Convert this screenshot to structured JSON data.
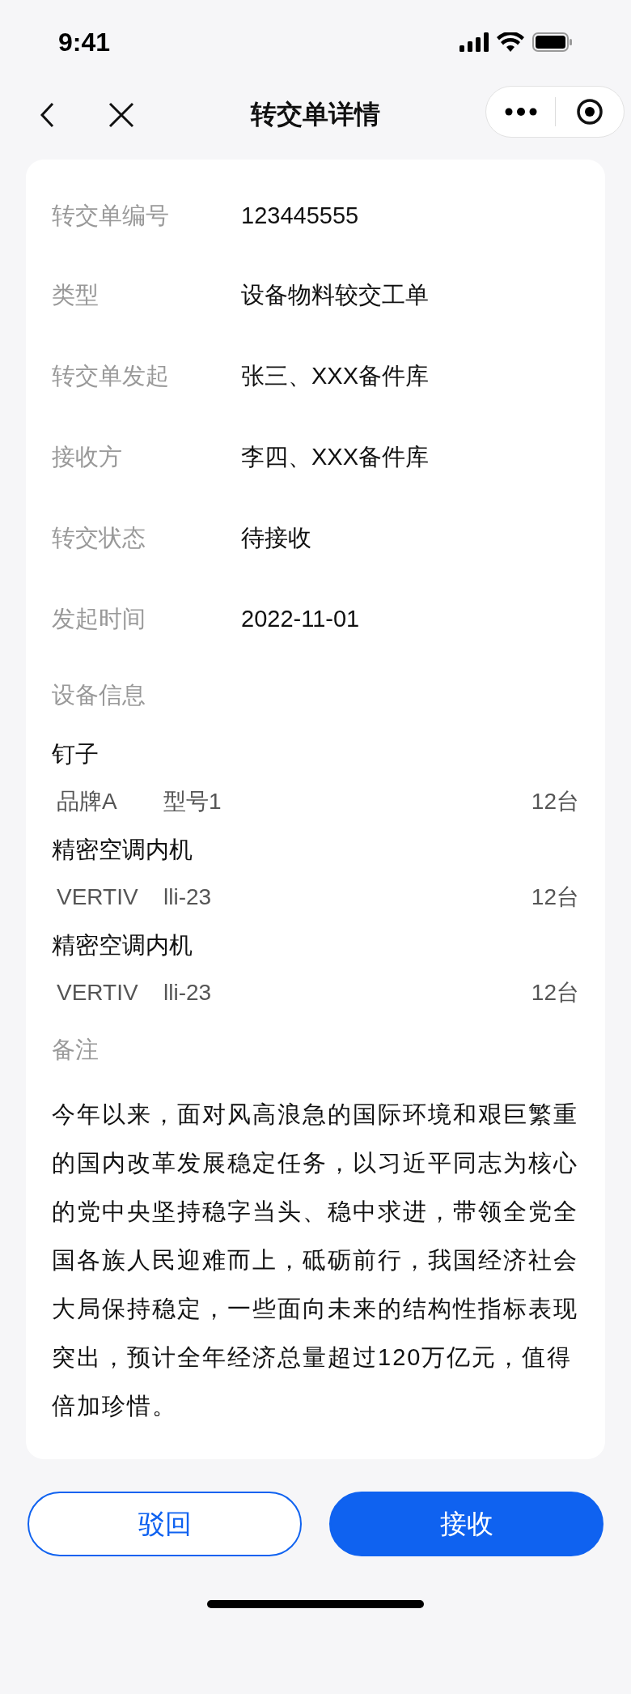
{
  "status_bar": {
    "time": "9:41"
  },
  "nav": {
    "title": "转交单详情"
  },
  "fields": [
    {
      "label": "转交单编号",
      "value": "123445555"
    },
    {
      "label": "类型",
      "value": "设备物料较交工单"
    },
    {
      "label": "转交单发起",
      "value": "张三、XXX备件库"
    },
    {
      "label": "接收方",
      "value": "李四、XXX备件库"
    },
    {
      "label": "转交状态",
      "value": "待接收"
    },
    {
      "label": "发起时间",
      "value": "2022-11-01"
    }
  ],
  "equipment": {
    "title": "设备信息",
    "items": [
      {
        "name": "钉子",
        "brand": "品牌A",
        "model": "型号1",
        "quantity": "12台"
      },
      {
        "name": "精密空调内机",
        "brand": "VERTIV",
        "model": "lli-23",
        "quantity": "12台"
      },
      {
        "name": "精密空调内机",
        "brand": "VERTIV",
        "model": "lli-23",
        "quantity": "12台"
      }
    ]
  },
  "remarks": {
    "title": "备注",
    "text": "今年以来，面对风高浪急的国际环境和艰巨繁重的国内改革发展稳定任务，以习近平同志为核心的党中央坚持稳字当头、稳中求进，带领全党全国各族人民迎难而上，砥砺前行，我国经济社会大局保持稳定，一些面向未来的结构性指标表现突出，预计全年经济总量超过120万亿元，值得倍加珍惜。"
  },
  "buttons": [
    {
      "label": "驳回",
      "kind": "secondary"
    },
    {
      "label": "接收",
      "kind": "primary"
    }
  ]
}
